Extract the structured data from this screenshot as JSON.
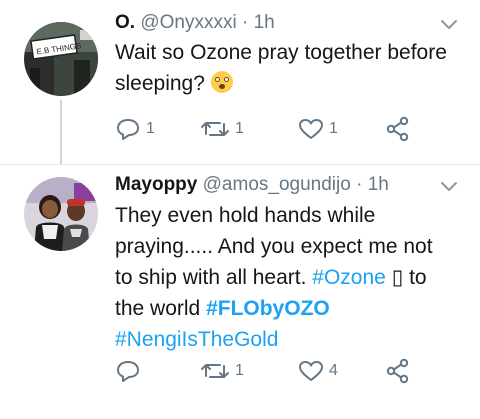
{
  "tweets": [
    {
      "name": "O.",
      "handle": "@Onyxxxxi",
      "separator": "·",
      "time": "1h",
      "text_line1": "Wait so Ozone pray together before",
      "text_line2": "sleeping?",
      "emoji": "flushed-face",
      "counts": {
        "reply": "1",
        "retweet": "1",
        "like": "1"
      }
    },
    {
      "name": "Mayoppy",
      "handle": "@amos_ogundijo",
      "separator": "·",
      "time": "1h",
      "text_line1": "They even hold hands while",
      "text_line2": "praying..... And you expect me not",
      "text_line3_pre": "to ship with all heart.",
      "hashtag_ozone": "#Ozone",
      "box_glyph": "▯",
      "text_line3_post": "to",
      "text_line4_pre": "the world",
      "hashtag_floby": "#FLObyOZO",
      "hashtag_nengi": "#NengiIsTheGold",
      "counts": {
        "reply": "",
        "retweet": "1",
        "like": "4"
      }
    }
  ],
  "colors": {
    "accent": "#1da1f2",
    "secondary_text": "#657786",
    "primary_text": "#14171a"
  }
}
